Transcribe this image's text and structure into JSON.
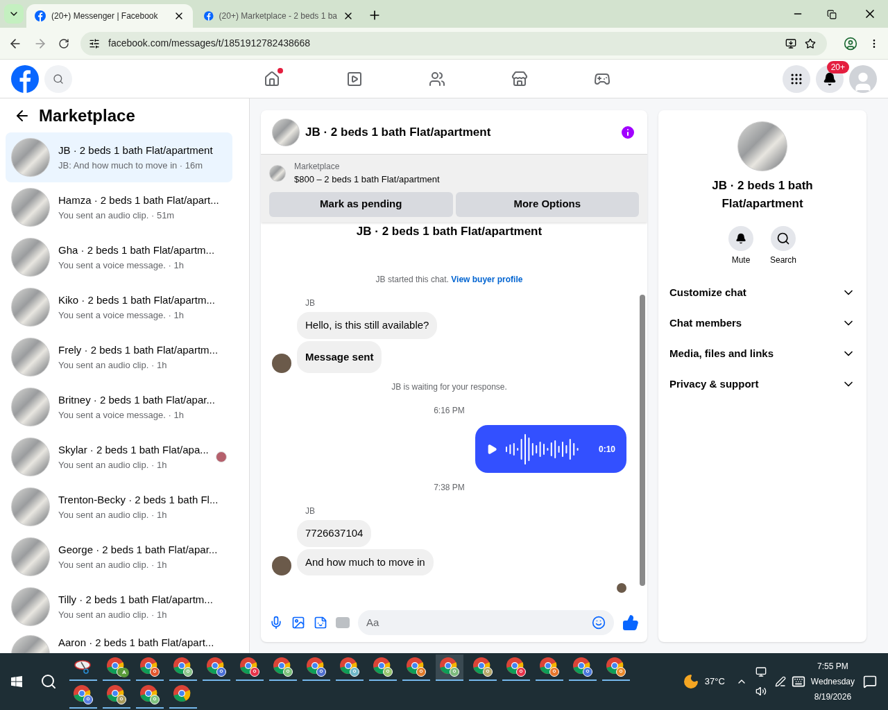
{
  "browser": {
    "tabs": [
      {
        "title": "(20+) Messenger | Facebook",
        "selected": true
      },
      {
        "title": "(20+) Marketplace - 2 beds 1 ba",
        "selected": false
      }
    ],
    "url": "facebook.com/messages/t/1851912782438668"
  },
  "fb_nav": {
    "items": [
      {
        "kind": "home",
        "dot": true
      },
      {
        "kind": "video",
        "dot": false
      },
      {
        "kind": "friends",
        "dot": false
      },
      {
        "kind": "market",
        "dot": false
      },
      {
        "kind": "gaming",
        "dot": false
      }
    ],
    "notifications_badge": "20+"
  },
  "sidebar": {
    "title": "Marketplace",
    "chats": [
      {
        "title": "JB · 2 beds 1 bath Flat/apartment",
        "subtitle": "JB: And how much to move in · 16m",
        "selected": true,
        "seen": false
      },
      {
        "title": "Hamza · 2 beds 1 bath Flat/apart...",
        "subtitle": "You sent an audio clip. · 51m",
        "selected": false,
        "seen": false
      },
      {
        "title": "Gha · 2 beds 1 bath Flat/apartm...",
        "subtitle": "You sent a voice message. · 1h",
        "selected": false,
        "seen": false
      },
      {
        "title": "Kiko · 2 beds 1 bath Flat/apartm...",
        "subtitle": "You sent a voice message. · 1h",
        "selected": false,
        "seen": false
      },
      {
        "title": "Frely · 2 beds 1 bath Flat/apartm...",
        "subtitle": "You sent an audio clip. · 1h",
        "selected": false,
        "seen": false
      },
      {
        "title": "Britney · 2 beds 1 bath Flat/apar...",
        "subtitle": "You sent a voice message. · 1h",
        "selected": false,
        "seen": false
      },
      {
        "title": "Skylar · 2 beds 1 bath Flat/apa...",
        "subtitle": "You sent an audio clip. · 1h",
        "selected": false,
        "seen": true
      },
      {
        "title": "Trenton-Becky · 2 beds 1 bath Fl...",
        "subtitle": "You sent an audio clip. · 1h",
        "selected": false,
        "seen": false
      },
      {
        "title": "George · 2 beds 1 bath Flat/apar...",
        "subtitle": "You sent an audio clip. · 1h",
        "selected": false,
        "seen": false
      },
      {
        "title": "Tilly · 2 beds 1 bath Flat/apartm...",
        "subtitle": "You sent an audio clip. · 1h",
        "selected": false,
        "seen": false
      },
      {
        "title": "Aaron · 2 beds 1 bath Flat/apart...",
        "selected": false,
        "seen": false
      }
    ]
  },
  "chat": {
    "title": "JB · 2 beds 1 bath Flat/apartment",
    "listing": {
      "label": "Marketplace",
      "text": "$800 – 2 beds 1 bath Flat/apartment",
      "buttons": [
        "Mark as pending",
        "More Options"
      ]
    },
    "messages": [
      {
        "kind": "heading",
        "text": "JB · 2 beds 1 bath Flat/apartment"
      },
      {
        "kind": "system",
        "text": "JB started this chat.",
        "link": "View buyer profile"
      },
      {
        "kind": "sender",
        "text": "JB"
      },
      {
        "kind": "incoming",
        "text": "Hello, is this still available?",
        "avatar": false,
        "bold": false
      },
      {
        "kind": "incoming",
        "text": "Message sent",
        "avatar": true,
        "bold": true
      },
      {
        "kind": "system",
        "text": "JB is waiting for your response."
      },
      {
        "kind": "time",
        "text": "6:16 PM"
      },
      {
        "kind": "audio",
        "text": "0:10"
      },
      {
        "kind": "time",
        "text": "7:38 PM"
      },
      {
        "kind": "sender",
        "text": "JB"
      },
      {
        "kind": "incoming",
        "text": "7726637104",
        "avatar": false,
        "bold": false
      },
      {
        "kind": "incoming",
        "text": "And how much to move in",
        "avatar": true,
        "bold": false
      },
      {
        "kind": "seen"
      }
    ],
    "composer": {
      "placeholder": "Aa"
    }
  },
  "details": {
    "title": "JB · 2 beds 1 bath Flat/apartment",
    "actions": [
      {
        "kind": "mute",
        "label": "Mute"
      },
      {
        "kind": "search",
        "label": "Search"
      }
    ],
    "sections": [
      {
        "label": "Customize chat",
        "expanded": false
      },
      {
        "label": "Chat members",
        "expanded": false
      },
      {
        "label": "Media, files and links",
        "expanded": false
      },
      {
        "label": "Privacy & support",
        "expanded": false
      }
    ]
  },
  "taskbar": {
    "apps": [
      {
        "kind": "snip",
        "selected": false
      },
      {
        "kind": "chrome",
        "color": "#5a9a3a",
        "letter": "A",
        "selected": false
      },
      {
        "kind": "chrome",
        "color": "#e4572e",
        "selected": false
      },
      {
        "kind": "chrome",
        "color": "#8bc48a",
        "selected": false
      },
      {
        "kind": "chrome",
        "color": "#4a6fd8",
        "selected": false
      },
      {
        "kind": "chrome",
        "color": "#e8334a",
        "selected": false
      },
      {
        "kind": "chrome",
        "color": "#7cc07a",
        "selected": false
      },
      {
        "kind": "chrome",
        "color": "#4f6fcf",
        "selected": false
      },
      {
        "kind": "chrome",
        "color": "#6fb8c8",
        "selected": false
      },
      {
        "kind": "chrome",
        "color": "#96c46e",
        "selected": false
      },
      {
        "kind": "chrome",
        "color": "#e07b2a",
        "selected": false
      },
      {
        "kind": "chrome",
        "color": "#7dbb7d",
        "selected": true
      },
      {
        "kind": "chrome",
        "color": "#b5a86a",
        "selected": false
      },
      {
        "kind": "chrome",
        "color": "#e8334b",
        "selected": false
      },
      {
        "kind": "chrome",
        "color": "#e8762c",
        "selected": false
      },
      {
        "kind": "chrome",
        "color": "#4a78dc",
        "selected": false
      },
      {
        "kind": "chrome",
        "color": "#e8892c",
        "selected": false
      },
      {
        "kind": "chrome",
        "color": "#5b7fe0",
        "selected": false
      },
      {
        "kind": "chrome",
        "color": "#a89a5c",
        "selected": false
      },
      {
        "kind": "chrome",
        "color": "#7fc27f",
        "selected": false
      },
      {
        "kind": "chrome",
        "selected": false
      }
    ],
    "temperature": "37°C",
    "time": "7:55 PM",
    "day": "Wednesday",
    "date": "8/19/2026"
  }
}
